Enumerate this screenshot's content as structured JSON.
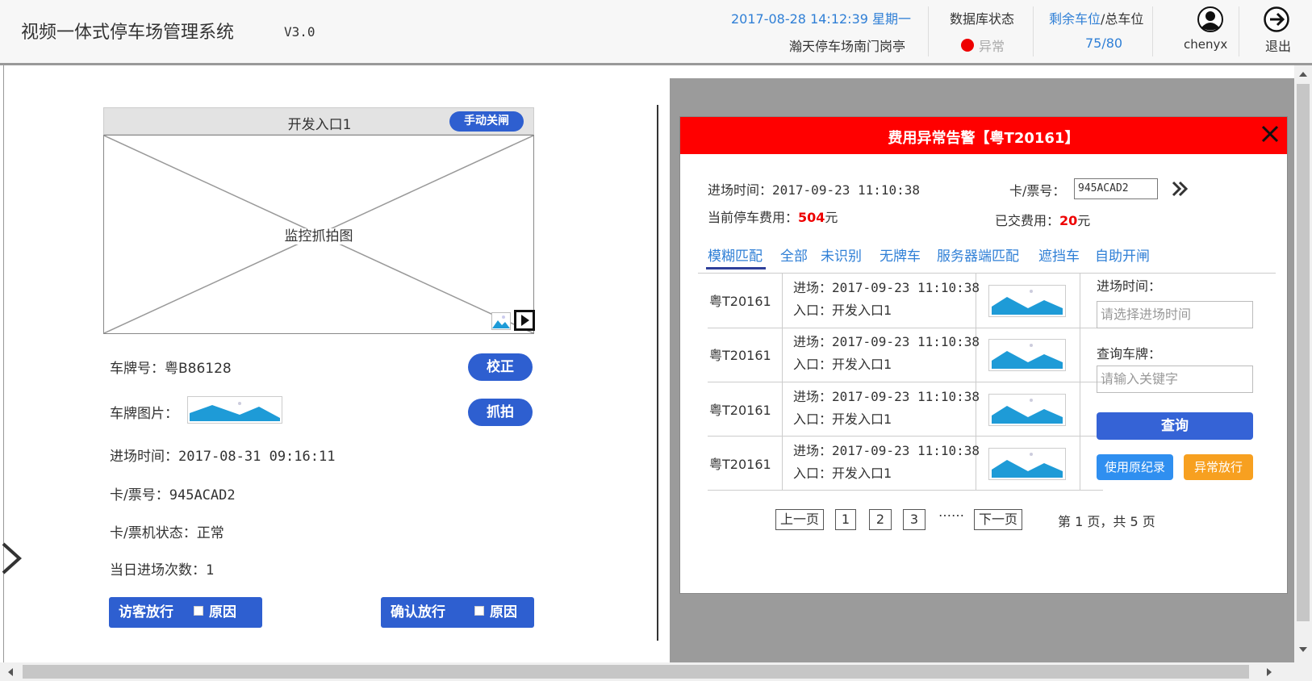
{
  "header": {
    "title": "视频一体式停车场管理系统",
    "version": "V3.0",
    "datetime": "2017-08-28 14:12:39 星期一",
    "booth": "瀚天停车场南门岗亭",
    "db_label": "数据库状态",
    "db_status": "异常",
    "spaces_label_a": "剩余车位",
    "spaces_label_sep": "/",
    "spaces_label_b": "总车位",
    "spaces_value": "75/80",
    "user": "chenyx",
    "logout": "退出",
    "icons": {
      "user": "user-avatar-icon",
      "logout": "logout-arrow-icon"
    },
    "colors": {
      "accent": "#2f7fd6",
      "db_error": "#e00000"
    }
  },
  "camera": {
    "entrance": "开发入口1",
    "manual_close": "手动关闸",
    "placeholder": "监控抓拍图"
  },
  "vehicle": {
    "plate_label": "车牌号：",
    "plate": "粤B86128",
    "correct_btn": "校正",
    "plate_img_label": "车牌图片：",
    "capture_btn": "抓拍",
    "entry_time_label": "进场时间：",
    "entry_time": "2017-08-31 09:16:11",
    "ticket_label": "卡/票号：",
    "ticket": "945ACAD2",
    "machine_label": "卡/票机状态：",
    "machine_status": "正常",
    "count_label": "当日进场次数：",
    "count": "1",
    "visitor_btn": "访客放行",
    "confirm_btn": "确认放行",
    "reason": "原因"
  },
  "modal": {
    "title": "费用异常告警【粤T20161】",
    "entry_time_label": "进场时间：",
    "entry_time": "2017-09-23 11:10:38",
    "ticket_label": "卡/票号：",
    "ticket": "945ACAD2",
    "fee_label": "当前停车费用：",
    "fee": "504",
    "paid_label": "已交费用：",
    "paid": "20",
    "unit": "元",
    "colors": {
      "header": "#ff0000",
      "amount": "#e00000"
    },
    "tabs": [
      "模糊匹配",
      "全部",
      "未识别",
      "无牌车",
      "服务器端匹配",
      "遮挡车",
      "自助开闸"
    ],
    "rows": [
      {
        "plate": "粤T20161",
        "entry": "进场：2017-09-23 11:10:38",
        "gate": "入口：开发入口1"
      },
      {
        "plate": "粤T20161",
        "entry": "进场：2017-09-23 11:10:38",
        "gate": "入口：开发入口1"
      },
      {
        "plate": "粤T20161",
        "entry": "进场：2017-09-23 11:10:38",
        "gate": "入口：开发入口1"
      },
      {
        "plate": "粤T20161",
        "entry": "进场：2017-09-23 11:10:38",
        "gate": "入口：开发入口1"
      }
    ],
    "side": {
      "entry_label": "进场时间：",
      "entry_placeholder": "请选择进场时间",
      "plate_label": "查询车牌：",
      "plate_placeholder": "请输入关键字",
      "query_btn": "查询",
      "use_orig_btn": "使用原纪录",
      "abnormal_btn": "异常放行"
    },
    "pagination": {
      "prev": "上一页",
      "pages": [
        "1",
        "2",
        "3"
      ],
      "ellipsis": "……",
      "next": "下一页",
      "summary": "第 1 页，共 5 页"
    }
  }
}
